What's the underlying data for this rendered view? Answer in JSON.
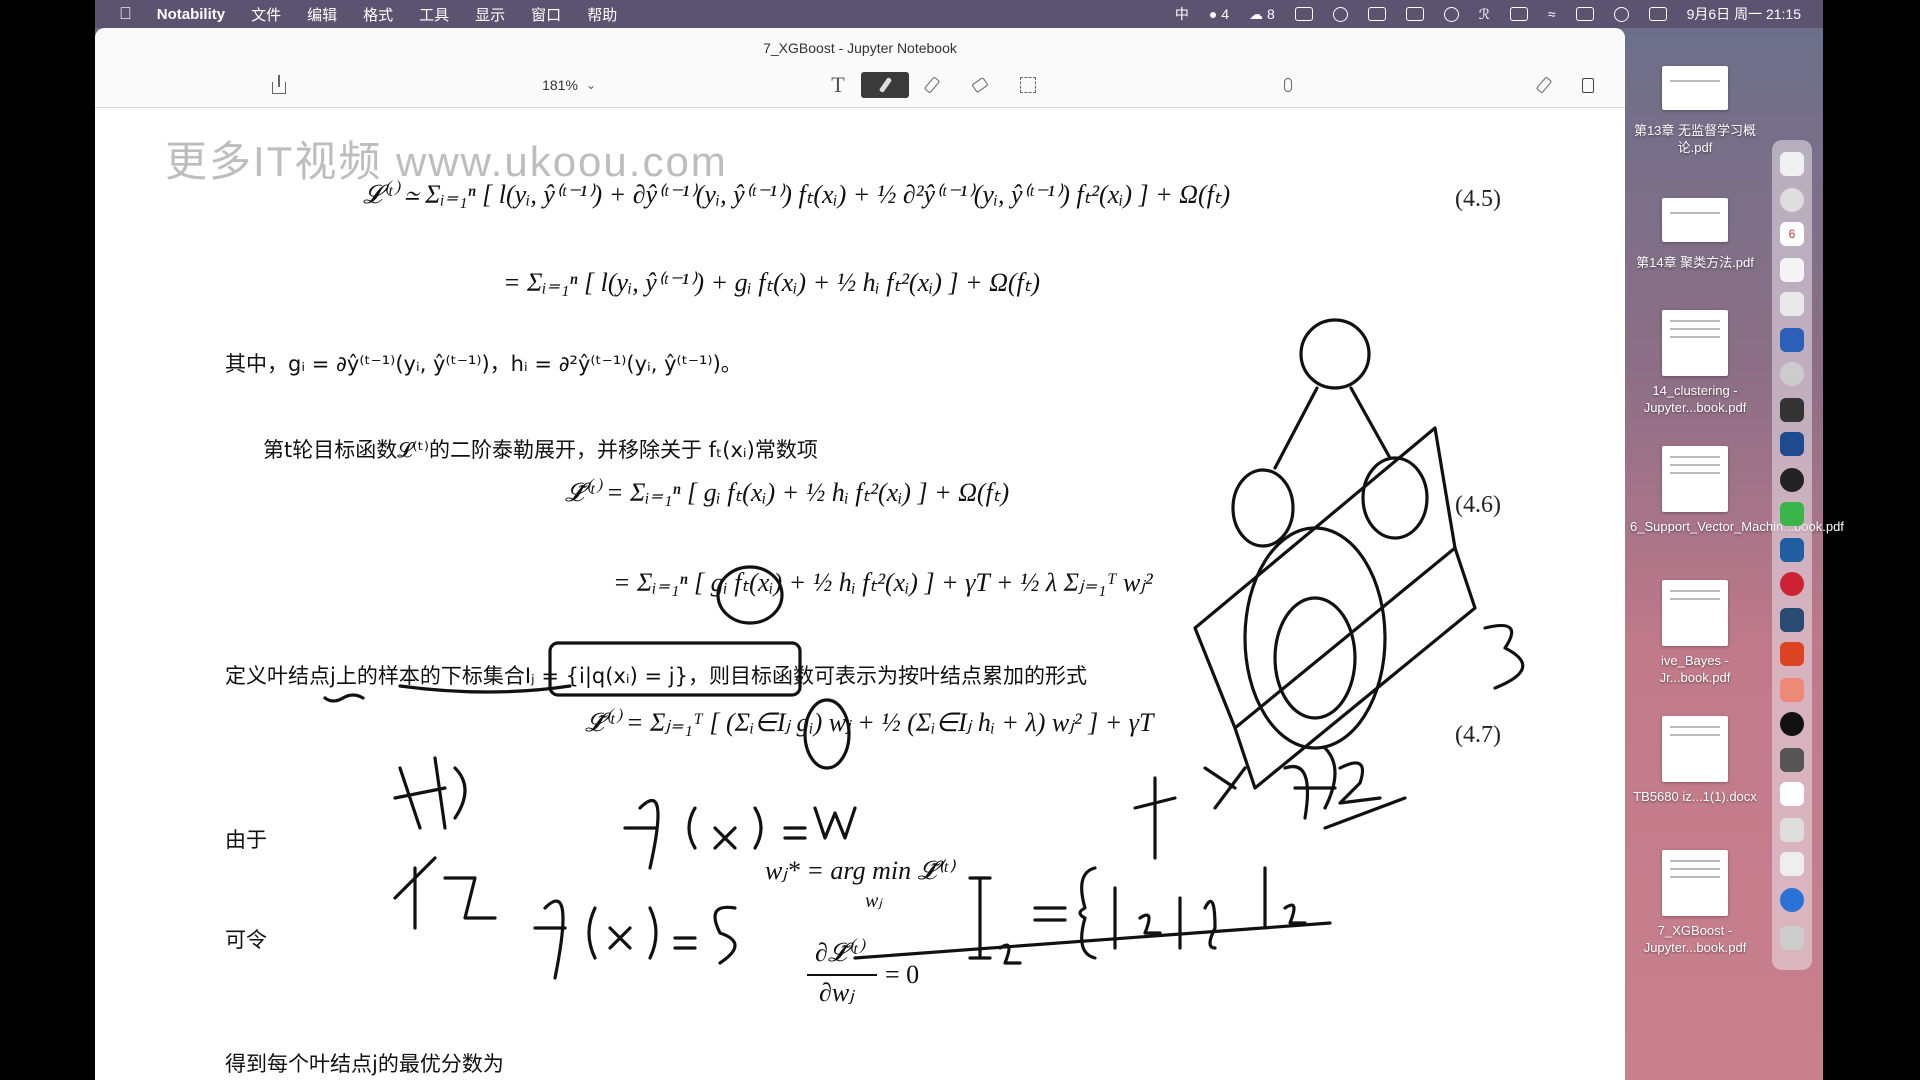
{
  "menubar": {
    "app_name": "Notability",
    "menus": [
      "文件",
      "编辑",
      "格式",
      "工具",
      "显示",
      "窗口",
      "帮助"
    ],
    "input_method": "中",
    "badge_a": "4",
    "badge_b": "8",
    "datetime": "9月6日 周一  21:15"
  },
  "window": {
    "title": "7_XGBoost - Jupyter Notebook",
    "zoom": "181%",
    "tool_text_glyph": "T"
  },
  "page": {
    "watermark": "更多IT视频  www.ukoou.com",
    "eq45_line1": "𝓛⁽ᵗ⁾ ≃ Σᵢ₌₁ⁿ [ l(yᵢ, ŷ⁽ᵗ⁻¹⁾) + ∂ŷ⁽ᵗ⁻¹⁾(yᵢ, ŷ⁽ᵗ⁻¹⁾) fₜ(xᵢ) + ½ ∂²ŷ⁽ᵗ⁻¹⁾(yᵢ, ŷ⁽ᵗ⁻¹⁾) fₜ²(xᵢ) ] + Ω(fₜ)",
    "eq45_line2": "= Σᵢ₌₁ⁿ [ l(yᵢ, ŷ⁽ᵗ⁻¹⁾) + gᵢ fₜ(xᵢ) + ½ hᵢ fₜ²(xᵢ) ] + Ω(fₜ)",
    "eq45_num": "(4.5)",
    "where_text": "其中，gᵢ = ∂ŷ⁽ᵗ⁻¹⁾(yᵢ, ŷ⁽ᵗ⁻¹⁾)，hᵢ = ∂²ŷ⁽ᵗ⁻¹⁾(yᵢ, ŷ⁽ᵗ⁻¹⁾)。",
    "taylor_text": "第t轮目标函数𝓛⁽ᵗ⁾的二阶泰勒展开，并移除关于 fₜ(xᵢ)常数项",
    "eq46_line1": "𝓛̃⁽ᵗ⁾ = Σᵢ₌₁ⁿ [ gᵢ fₜ(xᵢ) + ½ hᵢ fₜ²(xᵢ) ] + Ω(fₜ)",
    "eq46_line2": "= Σᵢ₌₁ⁿ [ gᵢ fₜ(xᵢ) + ½ hᵢ fₜ²(xᵢ) ] + γT + ½ λ Σⱼ₌₁ᵀ wⱼ²",
    "eq46_num": "(4.6)",
    "define_text": "定义叶结点j上的样本的下标集合Iⱼ = {i|q(xᵢ) = j}，则目标函数可表示为按叶结点累加的形式",
    "eq47": "𝓛̃⁽ᵗ⁾ = Σⱼ₌₁ᵀ [ (Σᵢ∈Iⱼ gᵢ) wⱼ + ½ (Σᵢ∈Iⱼ hᵢ + λ) wⱼ² ] + γT",
    "eq47_num": "(4.7)",
    "because_label": "由于",
    "argmin_eq": "wⱼ* = arg min 𝓛̃⁽ᵗ⁾",
    "argmin_sub": "wⱼ",
    "let_label": "可令",
    "deriv_num": "∂𝓛̃⁽ᵗ⁾",
    "deriv_den": "∂wⱼ",
    "deriv_rhs": "= 0",
    "optimal_text": "得到每个叶结点j的最优分数为"
  },
  "sidebar_files": [
    {
      "name": "第13章 无监督学习概论.pdf"
    },
    {
      "name": "第14章 聚类方法.pdf"
    },
    {
      "name": "14_clustering - Jupyter...book.pdf"
    },
    {
      "name": "6_Support_Vector_Machin...book.pdf"
    },
    {
      "name": "ive_Bayes - Jr...book.pdf"
    },
    {
      "name": "TB5680 iz...1(1).docx"
    },
    {
      "name": "7_XGBoost - Jupyter...book.pdf"
    }
  ],
  "dock_badge": "6",
  "colors": {
    "menubar": "#5a506e",
    "pen_tool": "#3a3a3a",
    "ink": "#111111"
  }
}
